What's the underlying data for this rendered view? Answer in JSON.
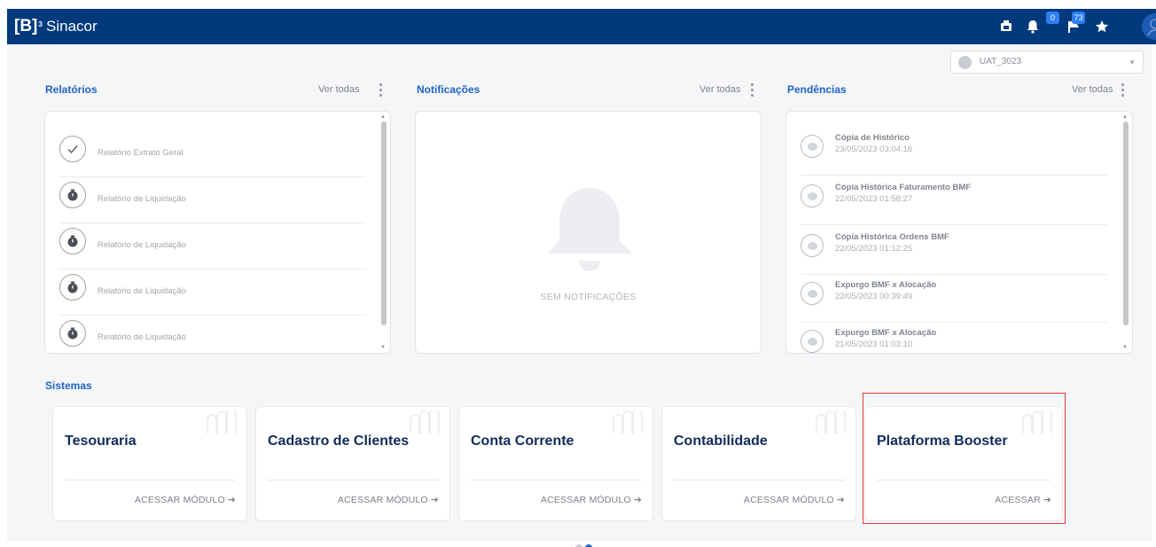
{
  "header": {
    "logo_text": "[B]",
    "logo_sup": "3",
    "app_title": "Sinacor",
    "icons": [
      "printer-icon",
      "bell-icon",
      "flag-icon",
      "star-icon",
      "user-icon"
    ],
    "notifications_badge": "0",
    "flags_badge": "73"
  },
  "environment": {
    "selected": "UAT_3023"
  },
  "relatorios": {
    "title": "Relatórios",
    "ver_todas": "Ver todas",
    "items": [
      {
        "label": "Relatório Extrato Geral",
        "icon": "check-icon"
      },
      {
        "label": "Relatório de Liquidação",
        "icon": "stopwatch-icon"
      },
      {
        "label": "Relatório de Liquidação",
        "icon": "stopwatch-icon"
      },
      {
        "label": "Relatório de Liquidação",
        "icon": "stopwatch-icon"
      },
      {
        "label": "Relatório de Liquidação",
        "icon": "stopwatch-icon"
      }
    ]
  },
  "notificacoes": {
    "title": "Notificações",
    "ver_todas": "Ver todas",
    "empty_text": "SEM NOTIFICAÇÕES"
  },
  "pendencias": {
    "title": "Pendências",
    "ver_todas": "Ver todas",
    "items": [
      {
        "title": "Cópia de Histórico",
        "date": "23/05/2023 03:04:16"
      },
      {
        "title": "Cópia Histórica Faturamento BMF",
        "date": "22/05/2023 01:58:27"
      },
      {
        "title": "Cópia Histórica Ordens BMF",
        "date": "22/05/2023 01:12:25"
      },
      {
        "title": "Expurgo BMF x Alocação",
        "date": "22/05/2023 00:39:49"
      },
      {
        "title": "Expurgo BMF x Alocação",
        "date": "21/05/2023 01:03:10"
      }
    ]
  },
  "sistemas": {
    "title": "Sistemas",
    "modules": [
      {
        "title": "Tesouraria",
        "link": "ACESSAR MÓDULO"
      },
      {
        "title": "Cadastro de Clientes",
        "link": "ACESSAR MÓDULO"
      },
      {
        "title": "Conta Corrente",
        "link": "ACESSAR MÓDULO"
      },
      {
        "title": "Contabilidade",
        "link": "ACESSAR MÓDULO"
      },
      {
        "title": "Plataforma Booster",
        "link": "ACESSAR"
      }
    ]
  },
  "colors": {
    "topbar": "#003a7d",
    "accent": "#1f62c7",
    "module_title": "#0f2b5b",
    "highlight": "#e03a3a"
  },
  "pagination": {
    "pages": 2,
    "active": 2
  }
}
